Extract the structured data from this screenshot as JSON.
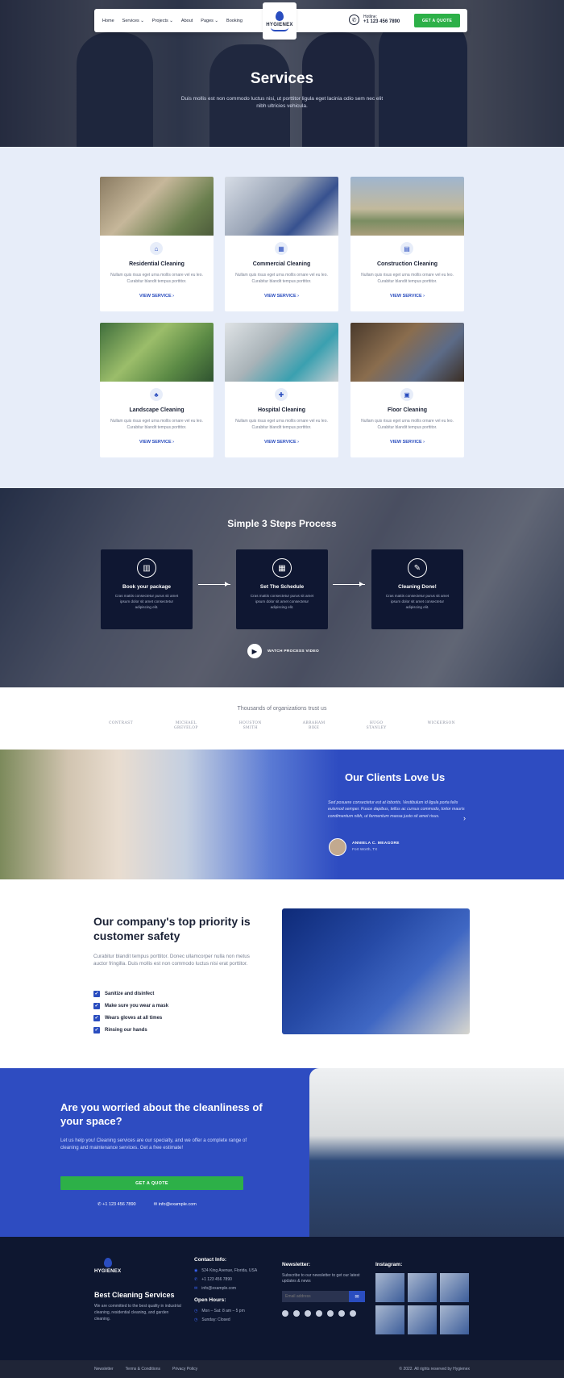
{
  "nav": {
    "menu": [
      "Home",
      "Services ⌄",
      "Projects ⌄",
      "About",
      "Pages ⌄",
      "Booking"
    ],
    "logo": "HYGIENEX",
    "contact_label": "Hotline:",
    "contact_phone": "+1 123 456 7890",
    "quote_button": "GET A QUOTE"
  },
  "hero": {
    "title": "Services",
    "subtitle": "Duis mollis est non commodo luctus nisi, ut porttitor ligula eget lacinia odio sem nec elit nibh ultricies vehicula."
  },
  "services": {
    "cards": [
      {
        "title": "Residential Cleaning",
        "text": "Nullam quis risus eget urna mollis ornare vel eu leo. Curabitur blandit tempus porttitor.",
        "link": "VIEW SERVICE ›",
        "icon": "home-icon"
      },
      {
        "title": "Commercial Cleaning",
        "text": "Nullam quis risus eget urna mollis ornare vel eu leo. Curabitur blandit tempus porttitor.",
        "link": "VIEW SERVICE ›",
        "icon": "building-icon"
      },
      {
        "title": "Construction Cleaning",
        "text": "Nullam quis risus eget urna mollis ornare vel eu leo. Curabitur blandit tempus porttitor.",
        "link": "VIEW SERVICE ›",
        "icon": "truck-icon"
      },
      {
        "title": "Landscape Cleaning",
        "text": "Nullam quis risus eget urna mollis ornare vel eu leo. Curabitur blandit tempus porttitor.",
        "link": "VIEW SERVICE ›",
        "icon": "tree-icon"
      },
      {
        "title": "Hospital Cleaning",
        "text": "Nullam quis risus eget urna mollis ornare vel eu leo. Curabitur blandit tempus porttitor.",
        "link": "VIEW SERVICE ›",
        "icon": "hospital-icon"
      },
      {
        "title": "Floor Cleaning",
        "text": "Nullam quis risus eget urna mollis ornare vel eu leo. Curabitur blandit tempus porttitor.",
        "link": "VIEW SERVICE ›",
        "icon": "floor-icon"
      }
    ]
  },
  "process": {
    "title": "Simple 3 Steps Process",
    "steps": [
      {
        "title": "Book your package",
        "text": "Cras mattis consectetur purus sit amet ipsum dolor sit amet consectetur adipiscing elit.",
        "icon": "clipboard-icon"
      },
      {
        "title": "Set The Schedule",
        "text": "Cras mattis consectetur purus sit amet ipsum dolor sit amet consectetur adipiscing elit.",
        "icon": "calendar-icon"
      },
      {
        "title": "Cleaning Done!",
        "text": "Cras mattis consectetur purus sit amet ipsum dolor sit amet consectetur adipiscing elit.",
        "icon": "broom-icon"
      }
    ],
    "video_label": "WATCH PROCESS VIDEO"
  },
  "trust": {
    "title": "Thousands of organizations trust us",
    "logos": [
      "CONTRAST",
      "MICHAEL\nGREVELOP",
      "HOUSTON\nSMITH",
      "ABRAHAM\nBIKE",
      "HUGO\nSTANLEY",
      "WICKERSON"
    ]
  },
  "testimonial": {
    "title": "Our Clients Love Us",
    "quote": "Sed posuere consectetur est at lobortis. Vestibulum id ligula porta felis euismod semper. Fusce dapibus, tellus ac cursus commodo, tortor mauris condimentum nibh, ut fermentum massa justo sit amet risus.",
    "name": "ANNIELA C. MEAGORE",
    "location": "Fort Worth, TX"
  },
  "priority": {
    "title": "Our company's top priority is customer safety",
    "desc": "Curabitur blandit tempus porttitor. Donec ullamcorper nulla non metus auctor fringilla. Duis mollis est non commodo luctus nisi erat porttitor.",
    "items": [
      "Sanitize and disinfect",
      "Make sure you wear a mask",
      "Wears gloves at all times",
      "Rinsing our hands"
    ]
  },
  "cta": {
    "title": "Are you worried about the cleanliness of your space?",
    "text": "Let us help you! Cleaning services are our specialty, and we offer a complete range of cleaning and maintenance services. Get a free estimate!",
    "button": "GET A QUOTE",
    "phone": "+1 123 456 7890",
    "email": "info@example.com"
  },
  "footer": {
    "logo": "HYGIENEX",
    "heading": "Best Cleaning Services",
    "about": "We are committed to the best quality in industrial cleaning, residential cleaning, and garden cleaning.",
    "contact_title": "Contact Info:",
    "address": "524 King Avenue, Florida, USA",
    "phone": "+1 123 456 7890",
    "email": "info@example.com",
    "hours_title": "Open Hours:",
    "hours": "Mon – Sat: 8 am – 5 pm",
    "closed": "Sunday: Closed",
    "newsletter_title": "Newsletter:",
    "newsletter_text": "Subscribe to our newsletter to get our latest updates & news",
    "email_placeholder": "Email address",
    "instagram_title": "Instagram:",
    "bottom_links": [
      "Newsletter",
      "Terms & Conditions",
      "Privacy Policy"
    ],
    "copyright": "© 2022. All rights reserved by Hygienex"
  },
  "colors": {
    "accent": "#2a4dbf",
    "green": "#2db048",
    "dark": "#0e1730",
    "light_bg": "#e7edf9"
  }
}
